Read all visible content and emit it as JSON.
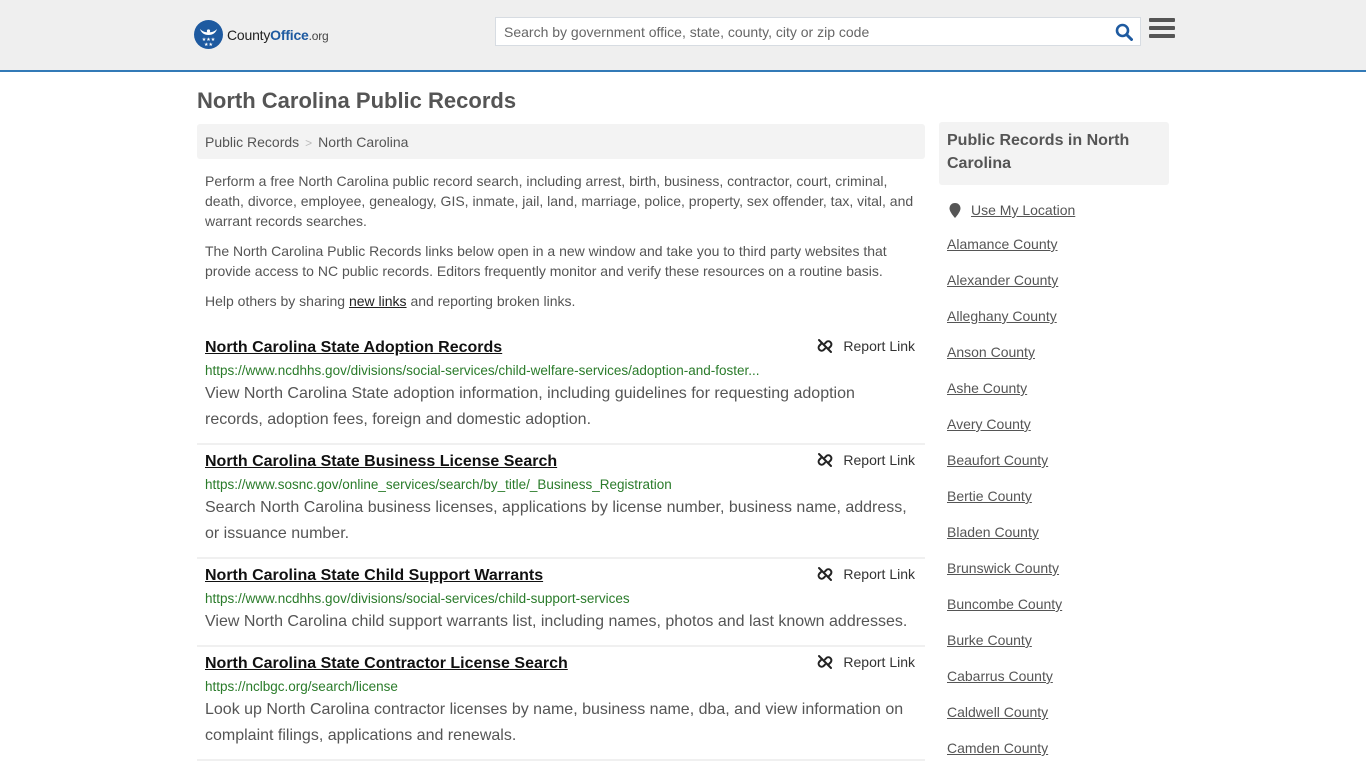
{
  "header": {
    "logo": {
      "county": "County",
      "office": "Office",
      "org": ".org"
    },
    "search_placeholder": "Search by government office, state, county, city or zip code",
    "search_icon": "search-icon",
    "menu_icon": "hamburger-menu-icon"
  },
  "page": {
    "title": "North Carolina Public Records"
  },
  "breadcrumb": {
    "items": [
      "Public Records",
      "North Carolina"
    ],
    "separator": ">"
  },
  "intro": {
    "p1": "Perform a free North Carolina public record search, including arrest, birth, business, contractor, court, criminal, death, divorce, employee, genealogy, GIS, inmate, jail, land, marriage, police, property, sex offender, tax, vital, and warrant records searches.",
    "p2": "The North Carolina Public Records links below open in a new window and take you to third party websites that provide access to NC public records. Editors frequently monitor and verify these resources on a routine basis.",
    "p3_before": "Help others by sharing ",
    "p3_link": "new links",
    "p3_after": " and reporting broken links."
  },
  "records": [
    {
      "title": "North Carolina State Adoption Records",
      "url": "https://www.ncdhhs.gov/divisions/social-services/child-welfare-services/adoption-and-foster...",
      "description": "View North Carolina State adoption information, including guidelines for requesting adoption records, adoption fees, foreign and domestic adoption.",
      "report_label": "Report Link"
    },
    {
      "title": "North Carolina State Business License Search",
      "url": "https://www.sosnc.gov/online_services/search/by_title/_Business_Registration",
      "description": "Search North Carolina business licenses, applications by license number, business name, address, or issuance number.",
      "report_label": "Report Link"
    },
    {
      "title": "North Carolina State Child Support Warrants",
      "url": "https://www.ncdhhs.gov/divisions/social-services/child-support-services",
      "description": "View North Carolina child support warrants list, including names, photos and last known addresses.",
      "report_label": "Report Link"
    },
    {
      "title": "North Carolina State Contractor License Search",
      "url": "https://nclbgc.org/search/license",
      "description": "Look up North Carolina contractor licenses by name, business name, dba, and view information on complaint filings, applications and renewals.",
      "report_label": "Report Link"
    }
  ],
  "sidebar": {
    "title": "Public Records in North Carolina",
    "use_location": "Use My Location",
    "counties": [
      "Alamance County",
      "Alexander County",
      "Alleghany County",
      "Anson County",
      "Ashe County",
      "Avery County",
      "Beaufort County",
      "Bertie County",
      "Bladen County",
      "Brunswick County",
      "Buncombe County",
      "Burke County",
      "Cabarrus County",
      "Caldwell County",
      "Camden County"
    ]
  },
  "colors": {
    "accent": "#337ab7",
    "logo_blue": "#1e5aa0",
    "url_green": "#2a7b2a",
    "search_icon": "#1e5aa0"
  }
}
